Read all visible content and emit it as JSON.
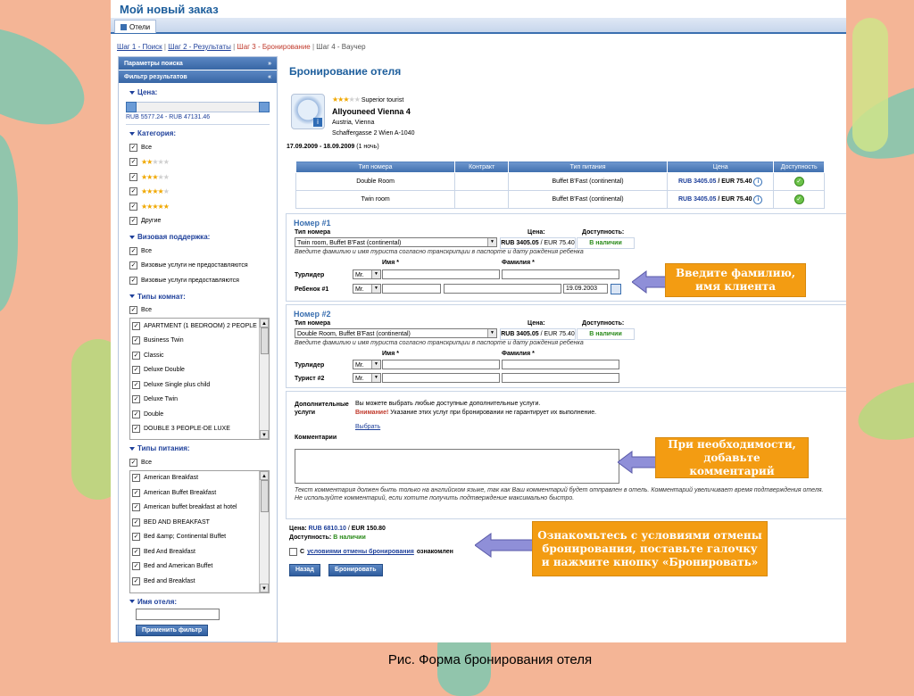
{
  "app": {
    "title": "Мой новый заказ",
    "tab": "Отели"
  },
  "steps": [
    {
      "label": "Шаг 1 - Поиск",
      "state": "link"
    },
    {
      "label": "Шаг 2 - Результаты",
      "state": "link"
    },
    {
      "label": "Шаг 3 - Бронирование",
      "state": "current"
    },
    {
      "label": "Шаг 4 - Ваучер",
      "state": "inactive"
    }
  ],
  "sidebar": {
    "search_params": "Параметры поиска",
    "search_params_icon": "»",
    "filter_results": "Фильтр результатов",
    "filter_results_icon": "«",
    "price": {
      "title": "Цена:",
      "range": "RUB 5577.24 - RUB 47131.46"
    },
    "category": {
      "title": "Категория:",
      "items": [
        {
          "label": "Все",
          "stars": 0
        },
        {
          "label": "",
          "stars": 2
        },
        {
          "label": "",
          "stars": 3
        },
        {
          "label": "",
          "stars": 4
        },
        {
          "label": "",
          "stars": 5
        },
        {
          "label": "Другие",
          "stars": 0
        }
      ]
    },
    "visa": {
      "title": "Визовая поддержка:",
      "items": [
        "Все",
        "Визовые услуги не предоставляются",
        "Визовые услуги предоставляются"
      ]
    },
    "rooms": {
      "title": "Типы комнат:",
      "all": "Все",
      "items": [
        "APARTMENT (1 BEDROOM) 2 PEOPLE",
        "Business Twin",
        "Classic",
        "Deluxe Double",
        "Deluxe Single plus child",
        "Deluxe Twin",
        "Double",
        "DOUBLE 3 PEOPLE-DE LUXE"
      ]
    },
    "meals": {
      "title": "Типы питания:",
      "all": "Все",
      "items": [
        "American Breakfast",
        "American Buffet Breakfast",
        "American buffet breakfast at hotel",
        "BED AND BREAKFAST",
        "Bed &amp; Continental Buffet",
        "Bed And Breakfast",
        "Bed and American Buffet",
        "Bed and Breakfast"
      ]
    },
    "hotel_name": {
      "title": "Имя отеля:"
    },
    "apply_button": "Применить фильтр"
  },
  "main": {
    "title": "Бронирование отеля",
    "hotel": {
      "stars": 3,
      "rating": "Superior tourist",
      "name": "Allyouneed Vienna 4",
      "location": "Austria, Vienna",
      "address": "Schaffergasse 2 Wien A-1040"
    },
    "dates": "17.09.2009 - 18.09.2009",
    "nights": "(1 ночь)",
    "table": {
      "headers": [
        "Тип номера",
        "Контракт",
        "Тип питания",
        "Цена",
        "Доступность"
      ],
      "rows": [
        {
          "room": "Double Room",
          "contract": "",
          "meal": "Buffet B'Fast (continental)",
          "price_rub": "RUB 3405.05",
          "price_eur": "EUR 75.40"
        },
        {
          "room": "Twin room",
          "contract": "",
          "meal": "Buffet B'Fast (continental)",
          "price_rub": "RUB 3405.05",
          "price_eur": "EUR 75.40"
        }
      ]
    },
    "rooms": [
      {
        "title": "Номер #1",
        "type_label": "Тип номера",
        "type_value": "Twin room, Buffet B'Fast (continental)",
        "price_label": "Цена:",
        "price_rub": "RUB 3405.05",
        "price_eur": "EUR 75.40",
        "avail_label": "Доступность:",
        "avail_value": "В наличии",
        "hint": "Введите фамилию и имя туриста согласно транскрипции в паспорте и дату рождения ребенка",
        "first_name_label": "Имя *",
        "last_name_label": "Фамилия *",
        "guests": [
          {
            "label": "Турлидер",
            "title": "Mr.",
            "birth": ""
          },
          {
            "label": "Ребенок #1",
            "title": "Mr.",
            "birth": "19.09.2003"
          }
        ]
      },
      {
        "title": "Номер #2",
        "type_label": "Тип номера",
        "type_value": "Double Room, Buffet B'Fast (continental)",
        "price_label": "Цена:",
        "price_rub": "RUB 3405.05",
        "price_eur": "EUR 75.40",
        "avail_label": "Доступность:",
        "avail_value": "В наличии",
        "hint": "Введите фамилию и имя туриста согласно транскрипции в паспорте и дату рождения ребенка",
        "first_name_label": "Имя *",
        "last_name_label": "Фамилия *",
        "guests": [
          {
            "label": "Турлидер",
            "title": "Mr."
          },
          {
            "label": "Турист #2",
            "title": "Mr."
          }
        ]
      }
    ],
    "extras": {
      "label": "Дополнительные услуги",
      "text": "Вы можете выбрать любые доступные дополнительные услуги.",
      "warning": "Внимание!",
      "warning_text": "Указание этих услуг при бронировании не гарантирует их выполнение.",
      "choose": "Выбрать",
      "comments_label": "Комментарии",
      "note": "Текст комментария должен быть только на английском языке, так как Ваш комментарий будет отправлен в отель. Комментарий увеличивает время подтверждения отеля. Не используйте комментарий, если хотите получить подтверждение максимально быстро."
    },
    "totals": {
      "price_label": "Цена:",
      "price_rub": "RUB 6810.10",
      "price_eur": "EUR 150.80",
      "avail_label": "Доступность:",
      "avail_value": "В наличии",
      "agree_prefix": "С",
      "agree_link": "условиями отмены бронирования",
      "agree_suffix": "ознакомлен"
    },
    "back_button": "Назад",
    "book_button": "Бронировать"
  },
  "callouts": {
    "surname": "Введите фамилию, имя клиента",
    "comment": "При необходимости, добавьте комментарий",
    "cancel": "Ознакомьтесь с условиями отмены бронирования, поставьте галочку и нажмите кнопку «Бронировать»"
  },
  "caption": "Рис. Форма бронирования отеля",
  "colors": {
    "accent": "#1d5e9c",
    "header_bar": "#3766a5",
    "callout": "#f39c12",
    "available": "#2a8a1a",
    "warning": "#c0392b"
  }
}
